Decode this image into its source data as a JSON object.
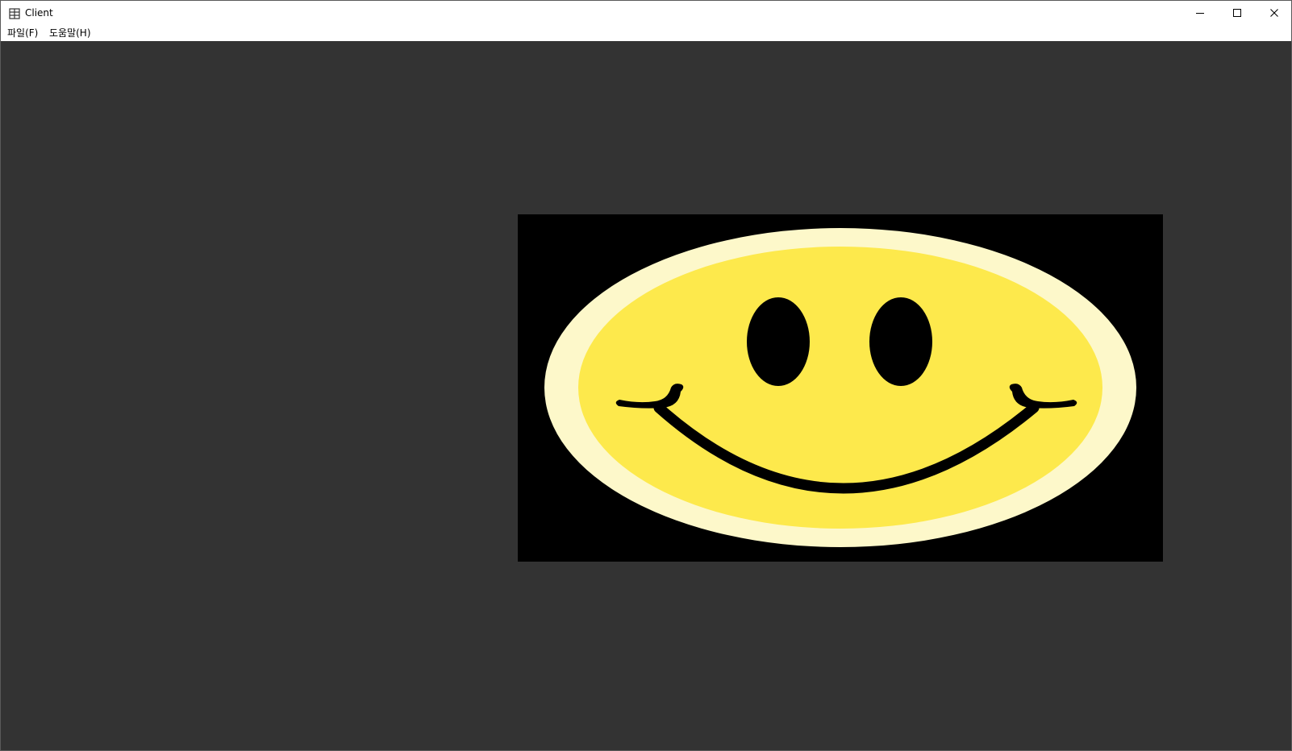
{
  "window": {
    "title": "Client",
    "app_icon": "app-icon",
    "controls": {
      "minimize_icon": "minimize-icon",
      "maximize_icon": "maximize-icon",
      "close_icon": "close-icon"
    }
  },
  "menu": {
    "items": [
      {
        "label": "파일(F)"
      },
      {
        "label": "도움말(H)"
      }
    ]
  },
  "colors": {
    "client_background": "#333333",
    "image_background": "#000000",
    "face_outer": "#fdf8ca",
    "face_inner": "#fde94c",
    "features": "#000000"
  },
  "content": {
    "image": "smiley-face"
  }
}
